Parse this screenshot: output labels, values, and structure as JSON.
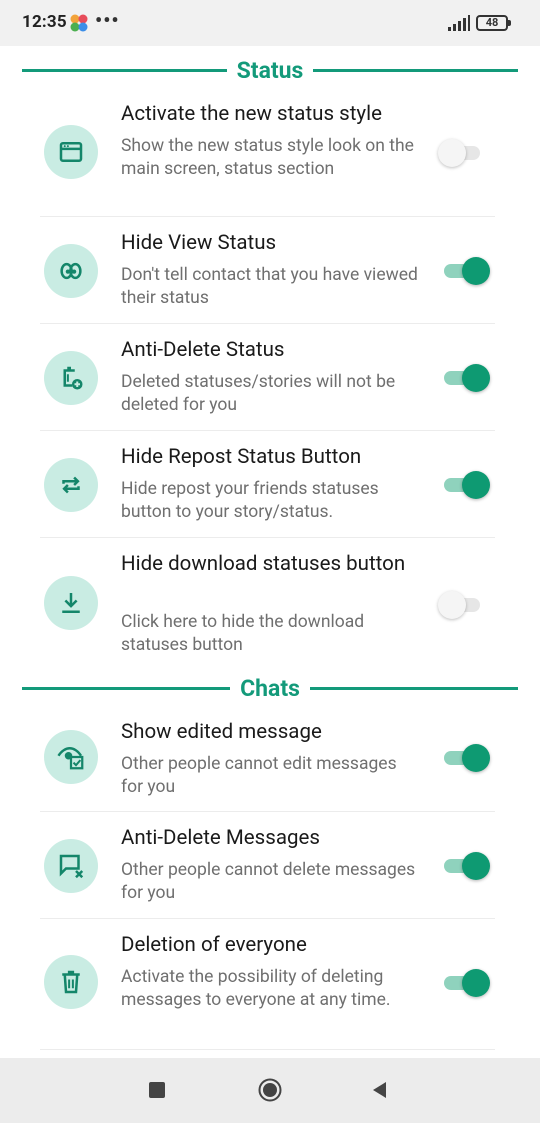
{
  "statusbar": {
    "time": "12:35",
    "dots": "•••",
    "battery": "48"
  },
  "sections": {
    "status": {
      "title": "Status"
    },
    "chats": {
      "title": "Chats"
    }
  },
  "status_items": [
    {
      "title": "Activate the new status style",
      "description": "Show the new status style look on the main screen, status section",
      "icon": "window-icon",
      "enabled": false
    },
    {
      "title": "Hide View Status",
      "description": "Don't tell contact that you have viewed their status",
      "icon": "eyes-icon",
      "enabled": true
    },
    {
      "title": "Anti-Delete Status",
      "description": "Deleted statuses/stories will not be deleted for you",
      "icon": "trash-add-icon",
      "enabled": true
    },
    {
      "title": "Hide Repost Status Button",
      "description": "Hide repost your friends statuses button to your story/status.",
      "icon": "repost-icon",
      "enabled": true
    },
    {
      "title": "Hide download statuses button",
      "description": "Click here to hide the download statuses button",
      "icon": "download-icon",
      "enabled": false
    }
  ],
  "chat_items": [
    {
      "title": "Show edited message",
      "description": "Other people cannot edit messages for you",
      "icon": "eye-edit-icon",
      "enabled": true
    },
    {
      "title": "Anti-Delete Messages",
      "description": "Other people cannot delete messages for you",
      "icon": "message-delete-icon",
      "enabled": true
    },
    {
      "title": "Deletion of everyone",
      "description": "Activate the possibility of deleting messages to everyone at any time.",
      "icon": "trash-icon",
      "enabled": true
    }
  ],
  "colors": {
    "accent": "#139a7a",
    "toggle_on": "#0e9a72",
    "toggle_track_on": "#8fd2bd",
    "icon_bg": "#c9ece3"
  }
}
